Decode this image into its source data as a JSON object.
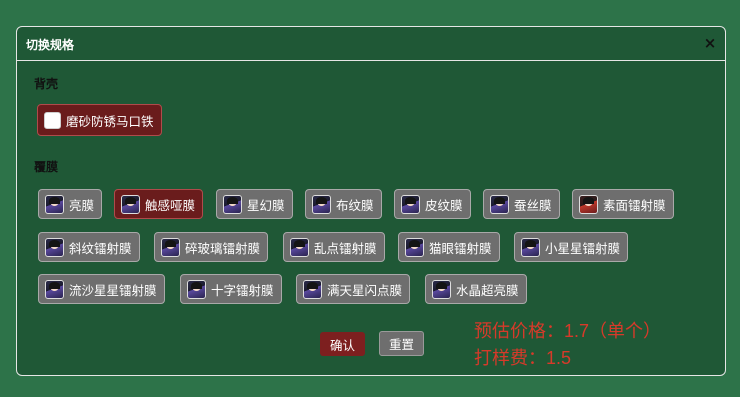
{
  "dialog": {
    "title": "切换规格",
    "close_label": "×"
  },
  "back_shell": {
    "label": "背壳",
    "options": [
      {
        "label": "磨砂防锈马口铁",
        "icon": "white-square-icon",
        "selected": true
      }
    ]
  },
  "film": {
    "label": "覆膜",
    "options": [
      {
        "label": "亮膜",
        "icon": "anime-thumb-icon",
        "selected": false
      },
      {
        "label": "触感哑膜",
        "icon": "anime-thumb-icon",
        "selected": true
      },
      {
        "label": "星幻膜",
        "icon": "anime-thumb-icon",
        "selected": false
      },
      {
        "label": "布纹膜",
        "icon": "anime-thumb-icon",
        "selected": false
      },
      {
        "label": "皮纹膜",
        "icon": "anime-thumb-icon",
        "selected": false
      },
      {
        "label": "蚕丝膜",
        "icon": "anime-thumb-icon",
        "selected": false
      },
      {
        "label": "素面镭射膜",
        "icon": "anime-thumb-icon",
        "selected": false
      },
      {
        "label": "斜纹镭射膜",
        "icon": "anime-thumb-icon",
        "selected": false
      },
      {
        "label": "碎玻璃镭射膜",
        "icon": "anime-thumb-icon",
        "selected": false
      },
      {
        "label": "乱点镭射膜",
        "icon": "anime-thumb-icon",
        "selected": false
      },
      {
        "label": "猫眼镭射膜",
        "icon": "anime-thumb-icon",
        "selected": false
      },
      {
        "label": "小星星镭射膜",
        "icon": "anime-thumb-icon",
        "selected": false
      },
      {
        "label": "流沙星星镭射膜",
        "icon": "anime-thumb-icon",
        "selected": false
      },
      {
        "label": "十字镭射膜",
        "icon": "anime-thumb-icon",
        "selected": false
      },
      {
        "label": "满天星闪点膜",
        "icon": "anime-thumb-icon",
        "selected": false
      },
      {
        "label": "水晶超亮膜",
        "icon": "anime-thumb-icon",
        "selected": false
      }
    ]
  },
  "actions": {
    "confirm_label": "确认",
    "reset_label": "重置"
  },
  "pricing": {
    "estimate": "预估价格：1.7（单个）",
    "sample_fee": "打样费：1.5"
  },
  "colors": {
    "page_bg": "#2d7349",
    "dialog_bg": "#1f5836",
    "selected_bg": "#6a1c1c",
    "option_bg": "#6e6e6e",
    "confirm_bg": "#7d1f1f",
    "price_text": "#d63a2a"
  }
}
